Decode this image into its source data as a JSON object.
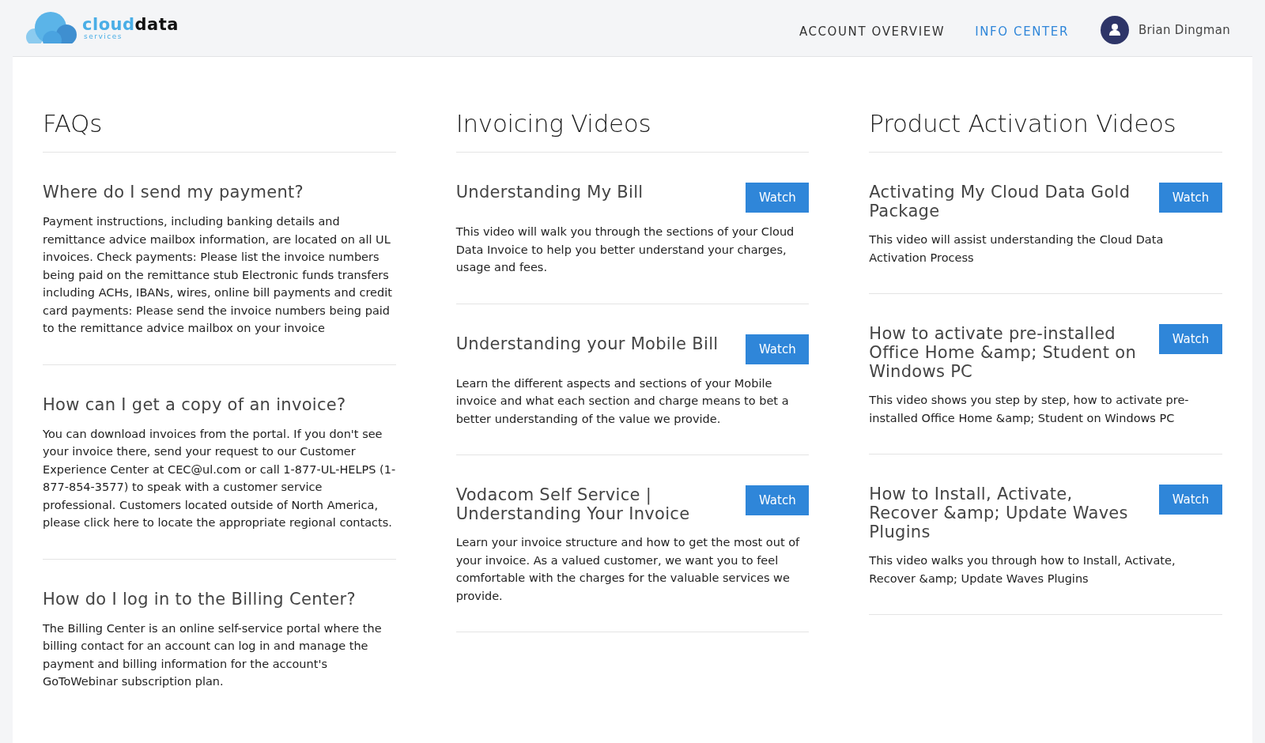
{
  "header": {
    "logo": {
      "word_1": "cloud",
      "word_2": "data",
      "tagline": "services"
    },
    "nav": [
      {
        "label": "ACCOUNT OVERVIEW",
        "selected": false
      },
      {
        "label": "INFO CENTER",
        "selected": true
      }
    ],
    "user": {
      "name": "Brian Dingman"
    }
  },
  "columns": [
    {
      "title": "FAQs",
      "items": [
        {
          "kind": "faq",
          "title": "Where do I send my payment?",
          "body": "Payment instructions, including banking details and remittance advice mailbox information, are located on all UL invoices. Check payments: Please list the invoice numbers being paid on the remittance stub Electronic funds transfers including ACHs, IBANs, wires, online bill payments and credit card payments: Please send the invoice numbers being paid to the remittance advice mailbox on your invoice"
        },
        {
          "kind": "faq",
          "title": "How can I get a copy of an invoice?",
          "body": "You can download invoices from the portal. If you don't see your invoice there, send your request to our Customer Experience Center at CEC@ul.com or call 1-877-UL-HELPS (1-877-854-3577) to speak with a customer service professional. Customers located outside of North America, please click here to locate the appropriate regional contacts."
        },
        {
          "kind": "faq",
          "title": "How do I log in to the Billing Center?",
          "body": "The Billing Center is an online self-service portal where the billing contact for an account can log in and manage the payment and billing information for the account's GoToWebinar subscription plan."
        }
      ]
    },
    {
      "title": "Invoicing Videos",
      "items": [
        {
          "kind": "video",
          "title": "Understanding My Bill",
          "button": "Watch",
          "body": "This video will walk you through the sections of your Cloud Data Invoice to help you better understand your charges, usage and fees."
        },
        {
          "kind": "video",
          "title": "Understanding your Mobile Bill",
          "button": "Watch",
          "body": "Learn the different aspects and sections of your Mobile invoice and what each section and charge means to bet a better understanding of the value we provide."
        },
        {
          "kind": "video",
          "title": "Vodacom Self Service | Understanding Your Invoice",
          "button": "Watch",
          "body": "Learn your invoice structure and how to get the most out of your invoice. As a valued customer, we want you to feel comfortable with the charges for the valuable services we provide."
        }
      ]
    },
    {
      "title": "Product Activation Videos",
      "items": [
        {
          "kind": "video",
          "title": "Activating My Cloud Data Gold Package",
          "button": "Watch",
          "body": "This video will assist understanding the Cloud Data Activation Process"
        },
        {
          "kind": "video",
          "title": "How to activate pre-installed Office Home &amp; Student on Windows PC",
          "button": "Watch",
          "body": "This video shows you step by step, how to activate pre-installed Office Home &amp; Student on Windows PC"
        },
        {
          "kind": "video",
          "title": "How to Install, Activate, Recover &amp; Update Waves Plugins",
          "button": "Watch",
          "body": "This video walks you through how to Install, Activate, Recover &amp; Update Waves Plugins"
        }
      ]
    }
  ]
}
